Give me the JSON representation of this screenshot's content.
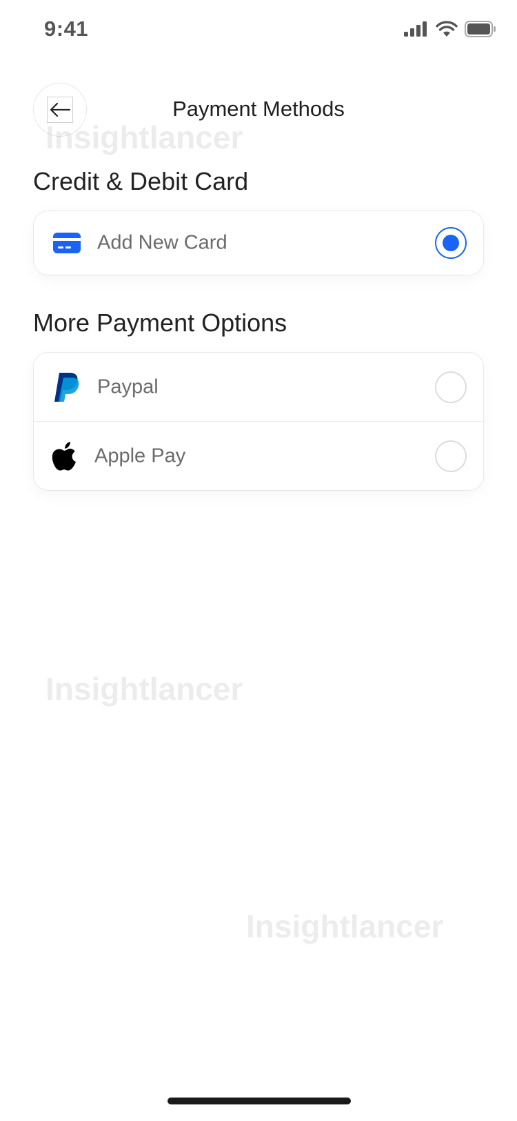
{
  "status_bar": {
    "time": "9:41"
  },
  "header": {
    "title": "Payment Methods",
    "back_icon": "arrow-left-icon"
  },
  "watermark": "Insightlancer",
  "credit_section": {
    "title": "Credit & Debit Card",
    "items": [
      {
        "label": "Add New Card",
        "icon": "credit-card-icon",
        "selected": true
      }
    ]
  },
  "more_section": {
    "title": "More Payment Options",
    "items": [
      {
        "label": "Paypal",
        "icon": "paypal-icon",
        "selected": false
      },
      {
        "label": "Apple Pay",
        "icon": "apple-icon",
        "selected": false
      }
    ]
  },
  "colors": {
    "accent": "#1a64f5",
    "paypal_dark": "#003087",
    "paypal_light": "#009cde"
  }
}
